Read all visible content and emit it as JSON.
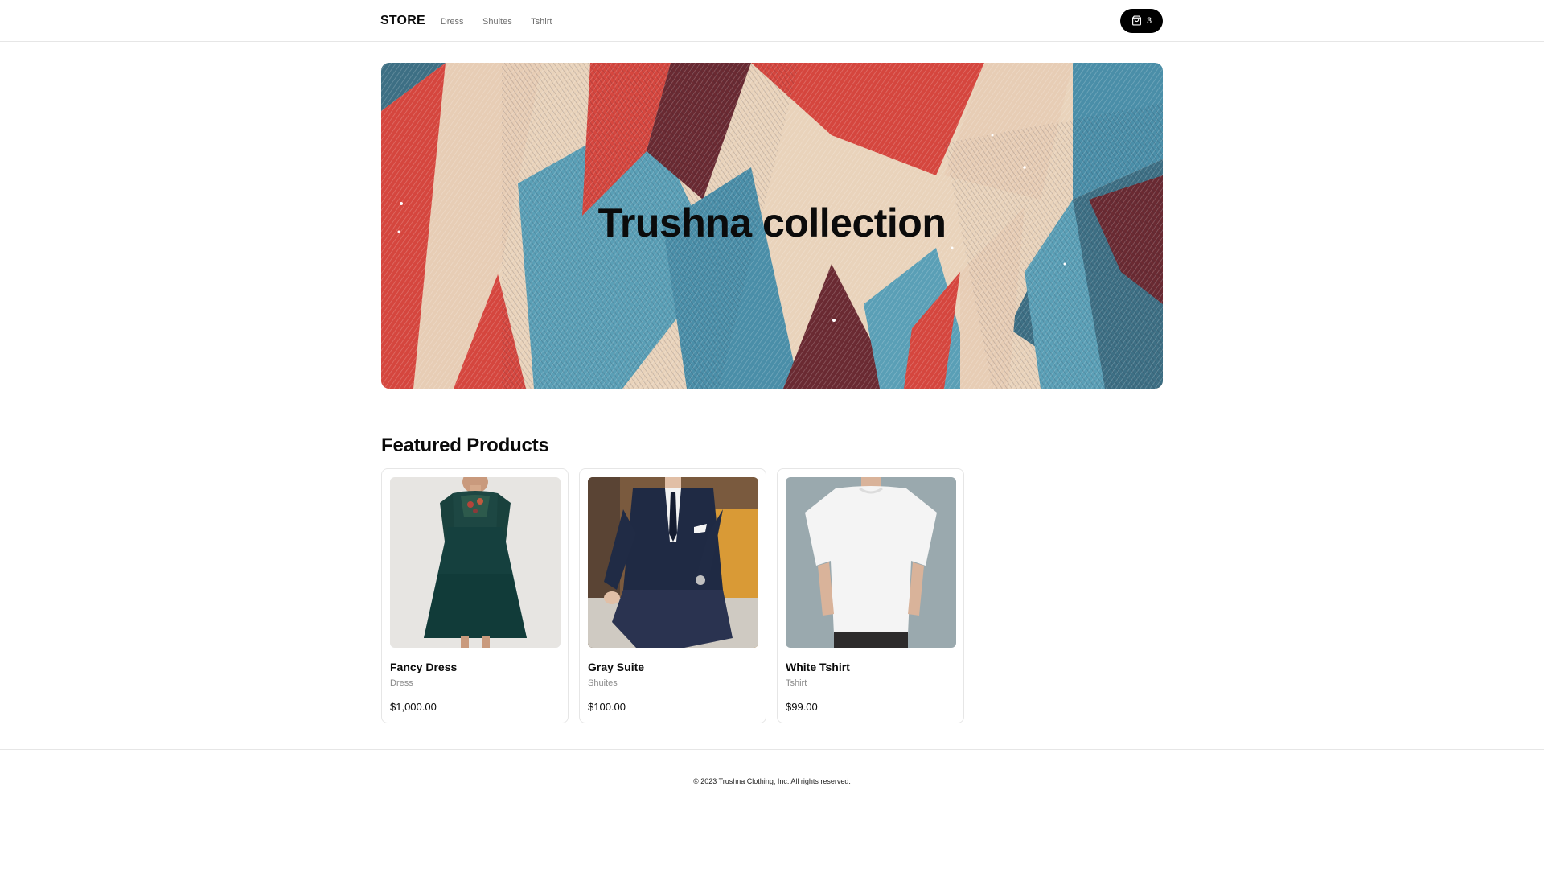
{
  "header": {
    "brand": "STORE",
    "nav": [
      "Dress",
      "Shuites",
      "Tshirt"
    ],
    "cart_icon": "shopping-bag-icon",
    "cart_count": "3"
  },
  "hero": {
    "title": "Trushna collection",
    "colors": {
      "red": "#d5463e",
      "cream": "#e9d3bb",
      "blue": "#5a9fb6",
      "maroon": "#6a2a32"
    }
  },
  "featured": {
    "title": "Featured Products",
    "products": [
      {
        "name": "Fancy Dress",
        "category": "Dress",
        "price": "$1,000.00"
      },
      {
        "name": "Gray Suite",
        "category": "Shuites",
        "price": "$100.00"
      },
      {
        "name": "White Tshirt",
        "category": "Tshirt",
        "price": "$99.00"
      }
    ]
  },
  "footer": {
    "copyright": "© 2023 Trushna Clothing, Inc. All rights reserved."
  }
}
